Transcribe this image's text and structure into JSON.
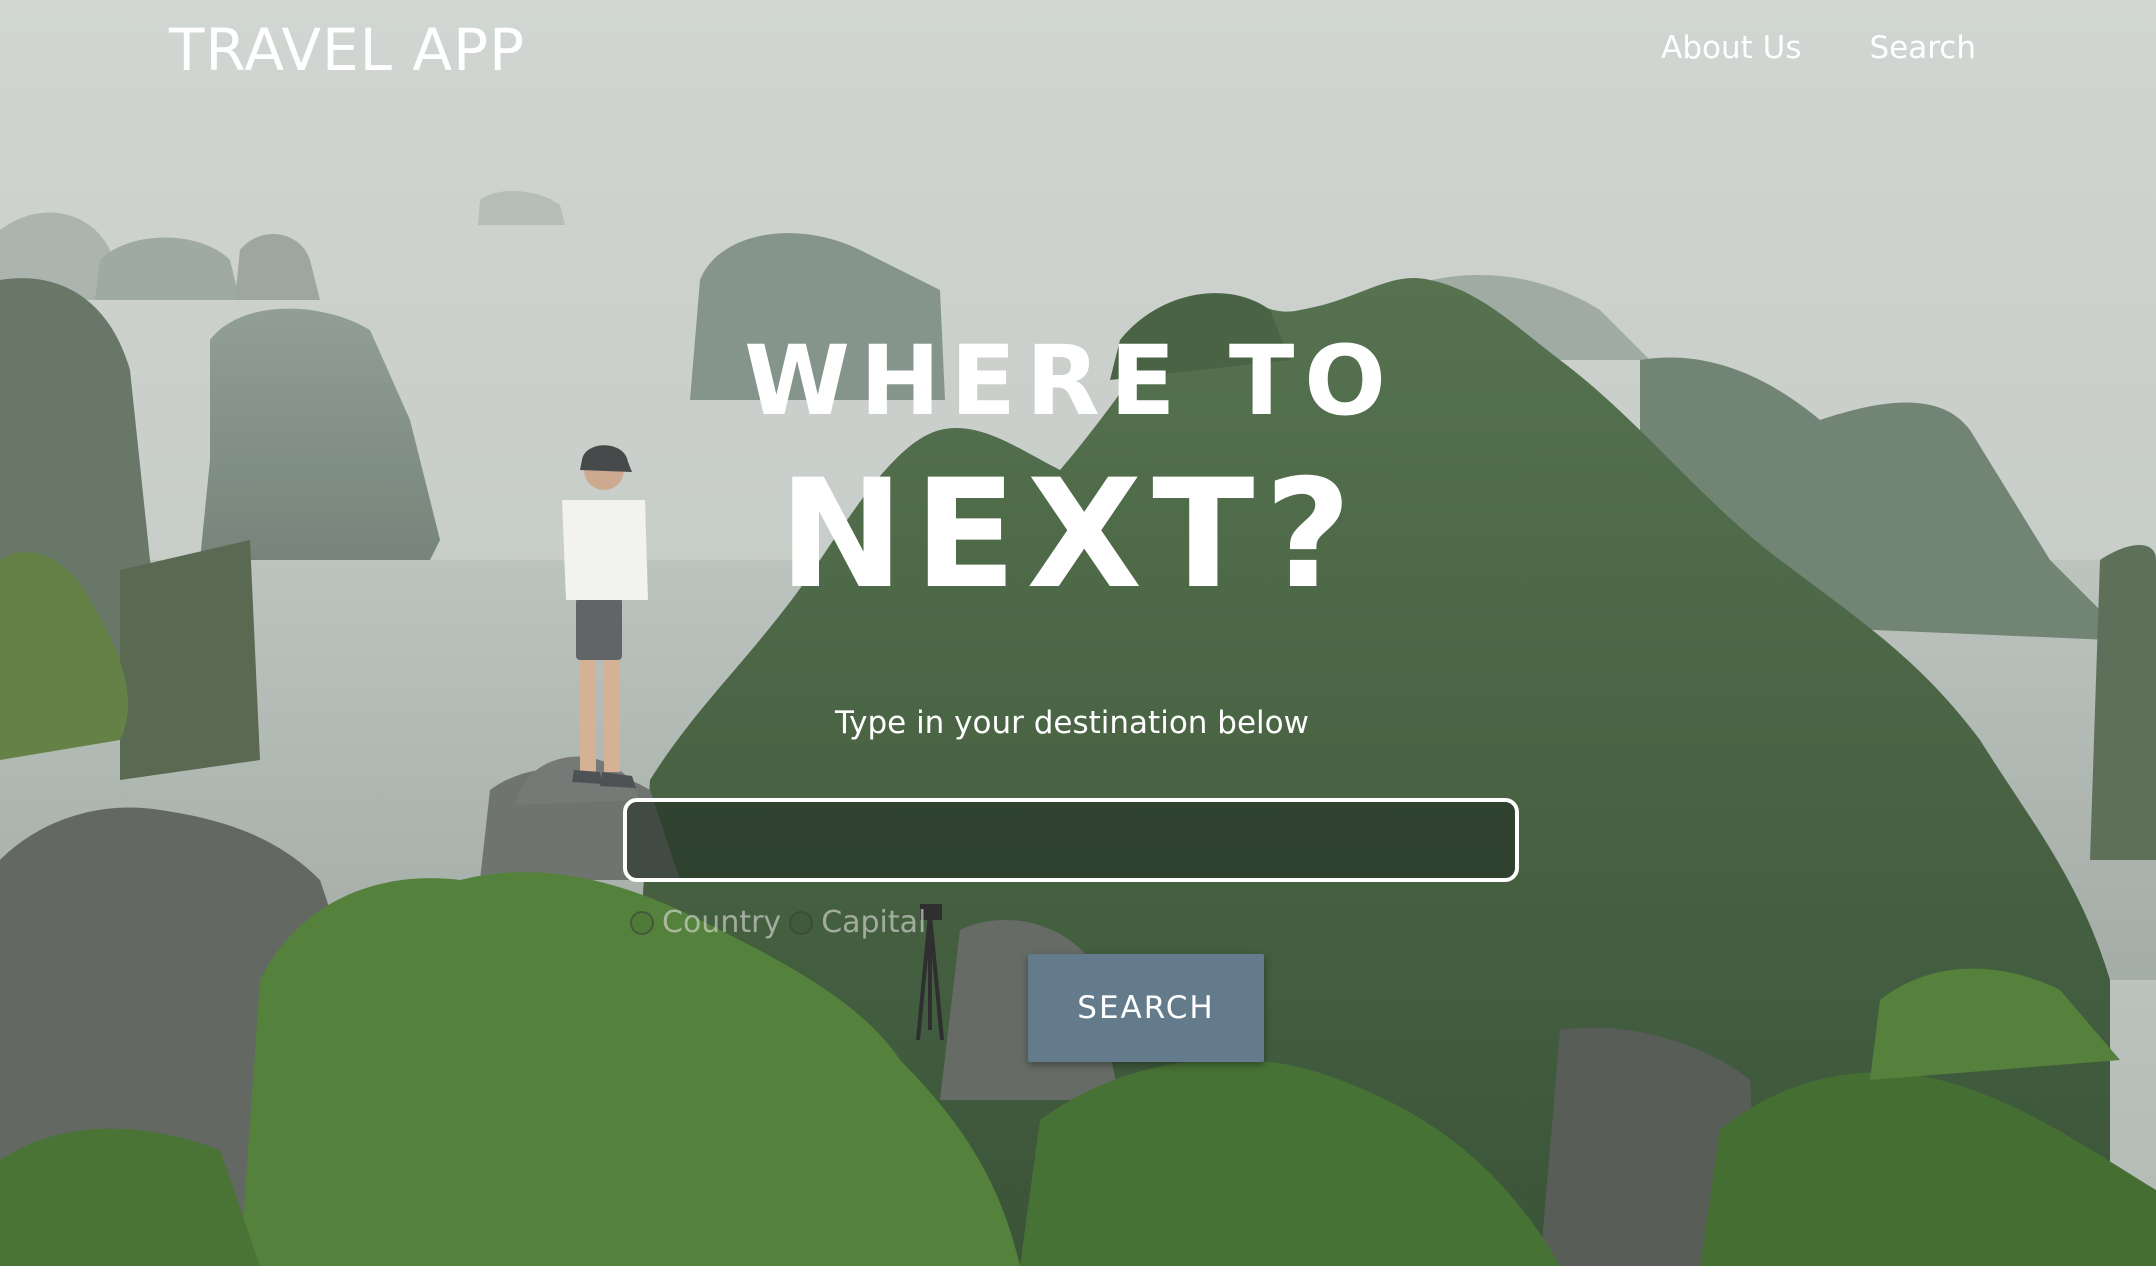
{
  "header": {
    "brand": "TRAVEL APP",
    "nav": [
      "About Us",
      "Search"
    ]
  },
  "hero": {
    "line1": "WHERE TO",
    "line2": "NEXT?",
    "subtitle": "Type in your destination below"
  },
  "search": {
    "input_value": "",
    "placeholder": "",
    "options": [
      "Country",
      "Capital"
    ],
    "button_label": "SEARCH"
  },
  "colors": {
    "button": "#647b8c",
    "text": "#ffffff",
    "sky": "#c6cbc6",
    "forest": "#3c5e34"
  }
}
